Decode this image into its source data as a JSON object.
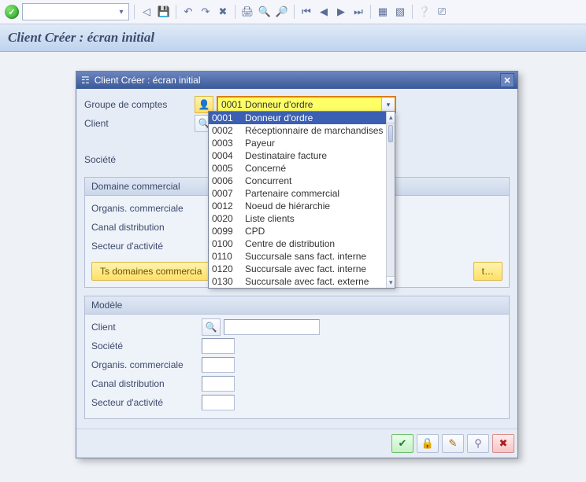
{
  "page": {
    "title": "Client Créer : écran initial"
  },
  "toolbar": {
    "command_value": ""
  },
  "dialog": {
    "title": "Client Créer : écran initial",
    "labels": {
      "groupe_comptes": "Groupe de comptes",
      "client": "Client",
      "societe": "Société"
    },
    "combo_selected": "0001 Donneur d'ordre",
    "group_commercial": {
      "title": "Domaine commercial",
      "organis": "Organis. commerciale",
      "canal": "Canal distribution",
      "secteur": "Secteur d'activité",
      "btn_all_domains": "Ts domaines commercia",
      "btn_extra": "t…"
    },
    "group_model": {
      "title": "Modèle",
      "client": "Client",
      "societe": "Société",
      "organis": "Organis. commerciale",
      "canal": "Canal distribution",
      "secteur": "Secteur d'activité"
    }
  },
  "dropdown": {
    "items": [
      {
        "code": "0001",
        "label": "Donneur d'ordre"
      },
      {
        "code": "0002",
        "label": "Réceptionnaire de marchandises"
      },
      {
        "code": "0003",
        "label": "Payeur"
      },
      {
        "code": "0004",
        "label": "Destinataire facture"
      },
      {
        "code": "0005",
        "label": "Concerné"
      },
      {
        "code": "0006",
        "label": "Concurrent"
      },
      {
        "code": "0007",
        "label": "Partenaire commercial"
      },
      {
        "code": "0012",
        "label": "Noeud de hiérarchie"
      },
      {
        "code": "0020",
        "label": "Liste clients"
      },
      {
        "code": "0099",
        "label": "CPD"
      },
      {
        "code": "0100",
        "label": "Centre de distribution"
      },
      {
        "code": "0110",
        "label": "Succursale sans fact. interne"
      },
      {
        "code": "0120",
        "label": "Succursale avec fact. interne"
      },
      {
        "code": "0130",
        "label": "Succursale avec fact. externe"
      }
    ],
    "selected_index": 0
  }
}
